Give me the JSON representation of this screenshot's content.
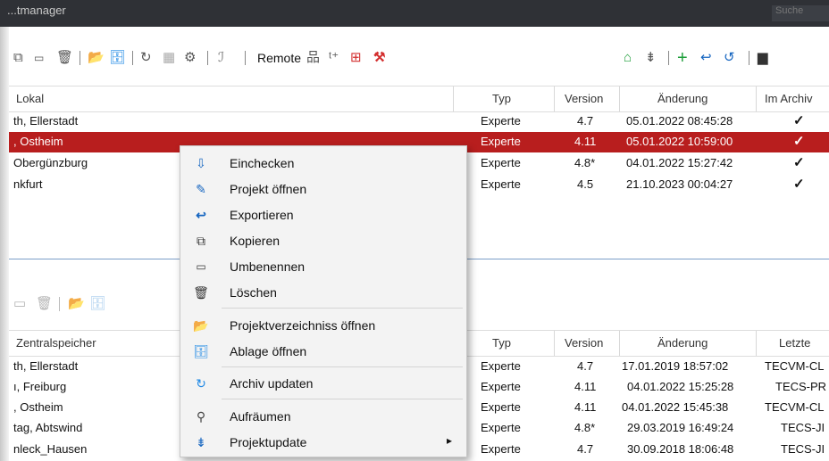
{
  "window": {
    "title": "...tmanager",
    "search_placeholder": "Suche"
  },
  "toolbar": {
    "remote_label": "Remote",
    "colors": {
      "green": "#1e9e3a",
      "blue": "#1565c0",
      "red": "#d32f2f",
      "orange": "#e6a23c"
    }
  },
  "local_table": {
    "headers": {
      "name": "Lokal",
      "type": "Typ",
      "version": "Version",
      "change": "Änderung",
      "archive": "Im Archiv"
    },
    "rows": [
      {
        "name": "th, Ellerstadt",
        "type": "Experte",
        "version": "4.7",
        "change": "05.01.2022 08:45:28",
        "archive": "✓",
        "selected": false
      },
      {
        "name": ", Ostheim",
        "type": "Experte",
        "version": "4.11",
        "change": "05.01.2022 10:59:00",
        "archive": "✓",
        "selected": true
      },
      {
        "name": "Obergünzburg",
        "type": "Experte",
        "version": "4.8*",
        "change": "04.01.2022 15:27:42",
        "archive": "✓",
        "selected": false
      },
      {
        "name": "nkfurt",
        "type": "Experte",
        "version": "4.5",
        "change": "21.10.2023 00:04:27",
        "archive": "✓",
        "selected": false
      }
    ]
  },
  "central_table": {
    "headers": {
      "name": "Zentralspeicher",
      "type": "Typ",
      "version": "Version",
      "change": "Änderung",
      "last": "Letzte"
    },
    "rows": [
      {
        "name": "th, Ellerstadt",
        "type": "Experte",
        "version": "4.7",
        "change": "17.01.2019 18:57:02",
        "last": "TECVM-CL"
      },
      {
        "name": "ı, Freiburg",
        "type": "Experte",
        "version": "4.11",
        "change": "04.01.2022 15:25:28",
        "last": "TECS-PR"
      },
      {
        "name": ", Ostheim",
        "type": "Experte",
        "version": "4.11",
        "change": "04.01.2022 15:45:38",
        "last": "TECVM-CL"
      },
      {
        "name": "tag, Abtswind",
        "type": "Experte",
        "version": "4.8*",
        "change": "29.03.2019 16:49:24",
        "last": "TECS-JI"
      },
      {
        "name": "nleck_Hausen",
        "type": "Experte",
        "version": "4.7",
        "change": "30.09.2018 18:06:48",
        "last": "TECS-JI"
      }
    ]
  },
  "context_menu": {
    "items": [
      {
        "label": "Einchecken",
        "icon": "checkin-icon"
      },
      {
        "label": "Projekt öffnen",
        "icon": "pencil-icon"
      },
      {
        "label": "Exportieren",
        "icon": "export-arrow-icon"
      },
      {
        "label": "Kopieren",
        "icon": "copy-icon"
      },
      {
        "label": "Umbenennen",
        "icon": "rename-icon"
      },
      {
        "label": "Löschen",
        "icon": "trash-icon"
      },
      {
        "label": "Projektverzeichniss öffnen",
        "icon": "folder-open-icon"
      },
      {
        "label": "Ablage öffnen",
        "icon": "storage-icon"
      },
      {
        "label": "Archiv updaten",
        "icon": "archive-update-icon"
      },
      {
        "label": "Aufräumen",
        "icon": "broom-icon"
      },
      {
        "label": "Projektupdate",
        "icon": "project-update-icon",
        "submenu_arrow": "▸"
      }
    ]
  }
}
